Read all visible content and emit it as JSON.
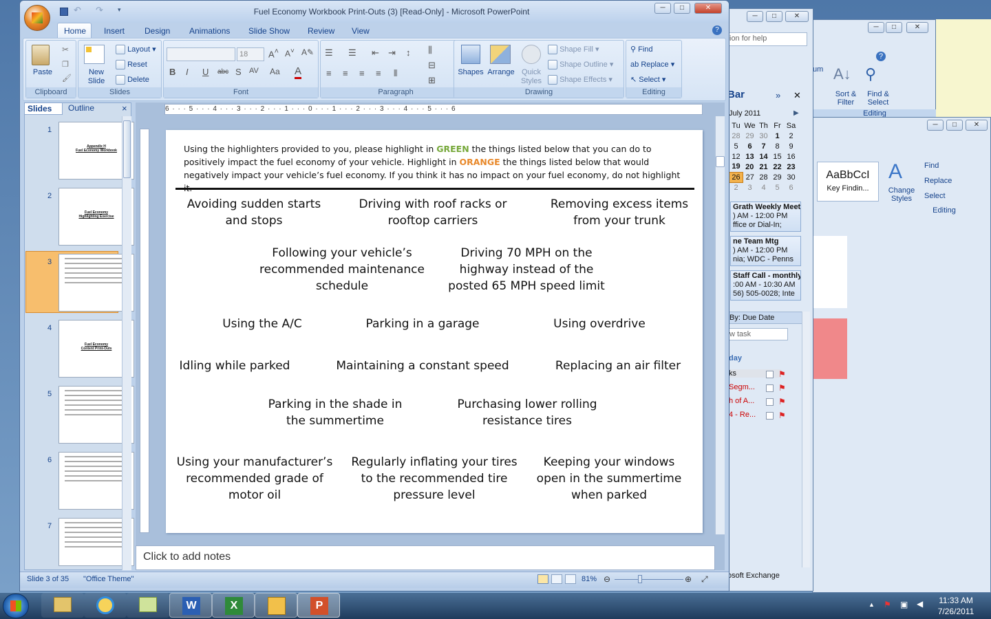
{
  "window": {
    "title": "Fuel Economy Workbook  Print-Outs (3) [Read-Only] - Microsoft PowerPoint",
    "min": "─",
    "max": "□",
    "close": "✕"
  },
  "ribbon": {
    "tabs": [
      "Home",
      "Insert",
      "Design",
      "Animations",
      "Slide Show",
      "Review",
      "View"
    ],
    "clipboard": {
      "paste": "Paste",
      "label": "Clipboard"
    },
    "slides": {
      "new_slide": "New Slide",
      "layout": "Layout",
      "reset": "Reset",
      "delete": "Delete",
      "label": "Slides"
    },
    "font": {
      "size": "18",
      "label": "Font"
    },
    "paragraph": {
      "label": "Paragraph"
    },
    "drawing": {
      "shapes": "Shapes",
      "arrange": "Arrange",
      "quick_styles": "Quick Styles",
      "shape_fill": "Shape Fill",
      "shape_outline": "Shape Outline",
      "shape_effects": "Shape Effects",
      "label": "Drawing"
    },
    "editing": {
      "find": "Find",
      "replace": "Replace",
      "select": "Select",
      "label": "Editing"
    }
  },
  "panel": {
    "slides_tab": "Slides",
    "outline_tab": "Outline",
    "close": "×"
  },
  "thumbs": [
    {
      "num": "1",
      "title": "Appendix H\nFuel Economy Workbook"
    },
    {
      "num": "2",
      "title": "Fuel Economy\nHighlighting Exercise"
    },
    {
      "num": "3",
      "title": ""
    },
    {
      "num": "4",
      "title": "Fuel Economy\nContent Print-Outs"
    },
    {
      "num": "5",
      "title": ""
    },
    {
      "num": "6",
      "title": ""
    },
    {
      "num": "7",
      "title": ""
    }
  ],
  "ruler": {
    "h": "6 · · · 5 · · · 4 · · · 3 · · · 2 · · · 1 · · · 0 · · · 1 · · · 2 · · · 3 · · · 4 · · · 5 · · · 6"
  },
  "slide": {
    "intro_a": "Using the highlighters provided to you, please highlight in ",
    "green": "GREEN",
    "intro_b": " the things listed below that you can do to positively impact the fuel economy of your vehicle. Highlight in ",
    "orange": "ORANGE",
    "intro_c": " the things listed below that would negatively impact your vehicle’s fuel economy. If you think it has no impact on your fuel economy, do not highlight it.",
    "items": [
      "Avoiding sudden starts and stops",
      "Driving with roof racks or rooftop carriers",
      "Removing excess items from your trunk",
      "Following your vehicle’s recommended maintenance schedule",
      "Driving 70 MPH on the highway instead of the posted 65 MPH speed limit",
      "Using the A/C",
      "Parking in a garage",
      "Using overdrive",
      "Idling while parked",
      "Maintaining a constant speed",
      "Replacing an air filter",
      "Parking in the shade in the summertime",
      "Purchasing lower rolling resistance tires",
      "Using your manufacturer’s recommended grade of motor oil",
      "Regularly inflating your tires to the recommended tire pressure level",
      "Keeping your windows open in the summertime when parked"
    ]
  },
  "notes": {
    "placeholder": "Click to add notes"
  },
  "status": {
    "slide": "Slide 3 of 35",
    "theme": "\"Office Theme\"",
    "zoom": "81%"
  },
  "outlook": {
    "help": "ion for help",
    "bar": "Bar",
    "month": "July 2011",
    "days": [
      "Tu",
      "We",
      "Th",
      "Fr",
      "Sa"
    ],
    "weeks": [
      [
        "28",
        "29",
        "30",
        "1",
        "2"
      ],
      [
        "5",
        "6",
        "7",
        "8",
        "9"
      ],
      [
        "12",
        "13",
        "14",
        "15",
        "16"
      ],
      [
        "19",
        "20",
        "21",
        "22",
        "23"
      ],
      [
        "26",
        "27",
        "28",
        "29",
        "30"
      ],
      [
        "2",
        "3",
        "4",
        "5",
        "6"
      ]
    ],
    "appts": [
      {
        "t": "Grath Weekly Meeti",
        "a": ") AM - 12:00 PM",
        "b": "ffice or Dial-In;"
      },
      {
        "t": "ne Team Mtg",
        "a": ") AM - 12:00 PM",
        "b": "nia; WDC - Penns"
      },
      {
        "t": "Staff Call - monthly",
        "a": ":00 AM - 10:30 AM",
        "b": "56) 505-0028; Inte"
      }
    ],
    "arranged": "By: Due Date",
    "newtask": "w task",
    "today": "day",
    "tasks": [
      "ks",
      "Segm...",
      "h of A...",
      "4 - Re..."
    ],
    "exchange": "osoft Exchange"
  },
  "word": {
    "style_sample": "AaBbCcI",
    "style_name": "Key Findin...",
    "change_styles": "Change Styles",
    "find": "Find",
    "replace": "Replace",
    "select": "Select",
    "editing": "Editing"
  },
  "excel": {
    "sort": "Sort & Filter",
    "find": "Find & Select",
    "editing": "Editing",
    "fum": "um"
  },
  "taskbar": {
    "time": "11:33 AM",
    "date": "7/26/2011"
  },
  "colors": {
    "green": "#76a83a",
    "orange": "#e8882a",
    "accent": "#15428b"
  }
}
